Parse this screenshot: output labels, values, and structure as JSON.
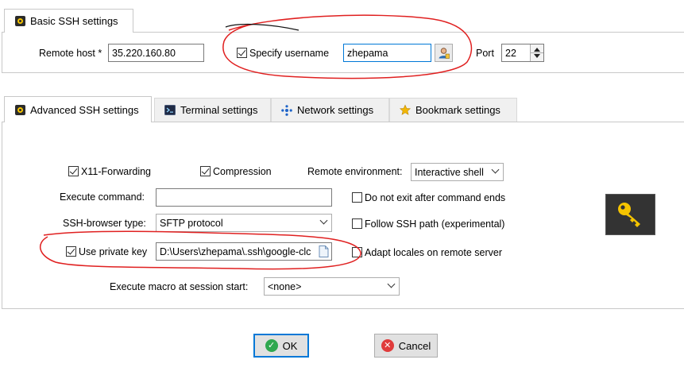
{
  "basic_tab": {
    "label": "Basic SSH settings"
  },
  "basic": {
    "remote_host_label": "Remote host *",
    "remote_host_value": "35.220.160.80",
    "specify_username_label": "Specify username",
    "specify_username_checked": true,
    "username_value": "zhepama",
    "user_icon": "user-icon",
    "port_label": "Port",
    "port_value": "22"
  },
  "tabs": [
    {
      "label": "Advanced SSH settings",
      "icon": "key-icon",
      "active": true
    },
    {
      "label": "Terminal settings",
      "icon": "terminal-icon",
      "active": false
    },
    {
      "label": "Network settings",
      "icon": "network-icon",
      "active": false
    },
    {
      "label": "Bookmark settings",
      "icon": "star-icon",
      "active": false
    }
  ],
  "advanced": {
    "x11_label": "X11-Forwarding",
    "x11_checked": true,
    "compression_label": "Compression",
    "compression_checked": true,
    "remote_env_label": "Remote environment:",
    "remote_env_value": "Interactive shell",
    "exec_command_label": "Execute command:",
    "exec_command_value": "",
    "no_exit_label": "Do not exit after command ends",
    "no_exit_checked": false,
    "ssh_browser_label": "SSH-browser type:",
    "ssh_browser_value": "SFTP protocol",
    "follow_path_label": "Follow SSH path (experimental)",
    "follow_path_checked": false,
    "private_key_label": "Use private key",
    "private_key_checked": true,
    "private_key_value": "D:\\Users\\zhepama\\.ssh\\google-clc",
    "adapt_locales_label": "Adapt locales on remote server",
    "adapt_locales_checked": false,
    "macro_label": "Execute macro at session start:",
    "macro_value": "<none>",
    "big_icon": "key-icon"
  },
  "buttons": {
    "ok_label": "OK",
    "cancel_label": "Cancel"
  },
  "colors": {
    "annotation_red": "#e02020",
    "accent_blue": "#0078d7",
    "ok_green": "#2fa84f",
    "cancel_red": "#e03c3c",
    "key_yellow": "#f5c400"
  }
}
